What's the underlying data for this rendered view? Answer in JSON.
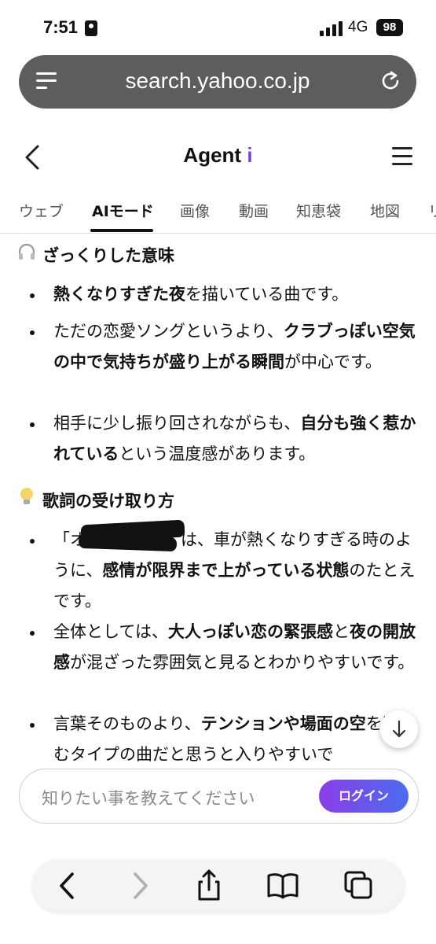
{
  "status": {
    "time": "7:51",
    "network": "4G",
    "battery": "98"
  },
  "browser": {
    "url": "search.yahoo.co.jp"
  },
  "header": {
    "brand_main": "Agent",
    "brand_accent": "i"
  },
  "tabs": [
    "ウェブ",
    "AIモード",
    "画像",
    "動画",
    "知恵袋",
    "地図",
    "リ"
  ],
  "sections": [
    {
      "icon": "headphones-icon",
      "title": "ざっくりした意味"
    },
    {
      "icon": "lightbulb-icon",
      "title": "歌詞の受け取り方"
    }
  ],
  "bullets": {
    "s1_b1": {
      "b1": "熱くなりすぎた夜",
      "t1": "を描いている曲です。"
    },
    "s1_b2": {
      "t1": "ただの恋愛ソングというより、",
      "b1": "クラブっぽい空気の中で気持ちが盛り上がる瞬間",
      "t2": "が中心です。"
    },
    "s1_b3": {
      "t1": "相手に少し振り回されながらも、",
      "b1": "自分も強く惹かれている",
      "t2": "という温度感があります。"
    },
    "s2_b1": {
      "t1": "「オ",
      "t2": "ト」は、車が熱くなりすぎる時のように、",
      "b1": "感情が限界まで上がっている状態",
      "t3": "のたとえです。"
    },
    "s2_b2": {
      "t1": "全体としては、",
      "b1": "大人っぽい恋の緊張感",
      "t2": "と",
      "b2": "夜の開放感",
      "t3": "が混ざった雰囲気と見るとわかりやすいです。"
    },
    "s2_b3": {
      "t1": "言葉そのものより、",
      "b1": "テンションや場面の空",
      "t2": "を楽しむタイプの曲だと思うと入りやすいで"
    }
  },
  "input": {
    "placeholder": "知りたい事を教えてください",
    "login_label": "ログイン"
  },
  "colors": {
    "accent": "#7b3fe4",
    "login_gradient_start": "#8a3ee6",
    "login_gradient_end": "#4b6cf0",
    "urlbar": "#5d5d5d"
  }
}
